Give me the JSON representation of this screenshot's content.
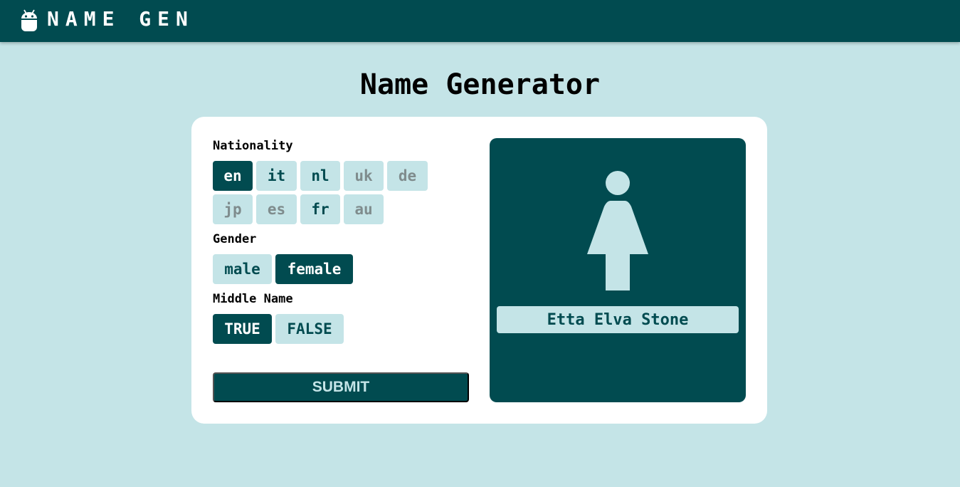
{
  "header": {
    "brand": "NAME GEN",
    "logo_icon": "android-icon"
  },
  "main": {
    "title": "Name Generator"
  },
  "form": {
    "nationality_label": "Nationality",
    "nationality_options": [
      {
        "label": "en",
        "state": "selected"
      },
      {
        "label": "it",
        "state": "available"
      },
      {
        "label": "nl",
        "state": "available"
      },
      {
        "label": "uk",
        "state": "disabled"
      },
      {
        "label": "de",
        "state": "disabled"
      },
      {
        "label": "jp",
        "state": "disabled"
      },
      {
        "label": "es",
        "state": "disabled"
      },
      {
        "label": "fr",
        "state": "available"
      },
      {
        "label": "au",
        "state": "disabled"
      }
    ],
    "gender_label": "Gender",
    "gender_options": [
      {
        "label": "male",
        "state": "available"
      },
      {
        "label": "female",
        "state": "selected"
      }
    ],
    "middle_name_label": "Middle Name",
    "middle_name_options": [
      {
        "label": "TRUE",
        "state": "selected"
      },
      {
        "label": "FALSE",
        "state": "available"
      }
    ],
    "submit_label": "SUBMIT"
  },
  "result": {
    "icon": "female-person-icon",
    "generated_name": "Etta Elva Stone"
  },
  "colors": {
    "primary": "#014b50",
    "light": "#c4e4e7",
    "card": "#ffffff",
    "disabled_text": "#7f8c8d"
  }
}
